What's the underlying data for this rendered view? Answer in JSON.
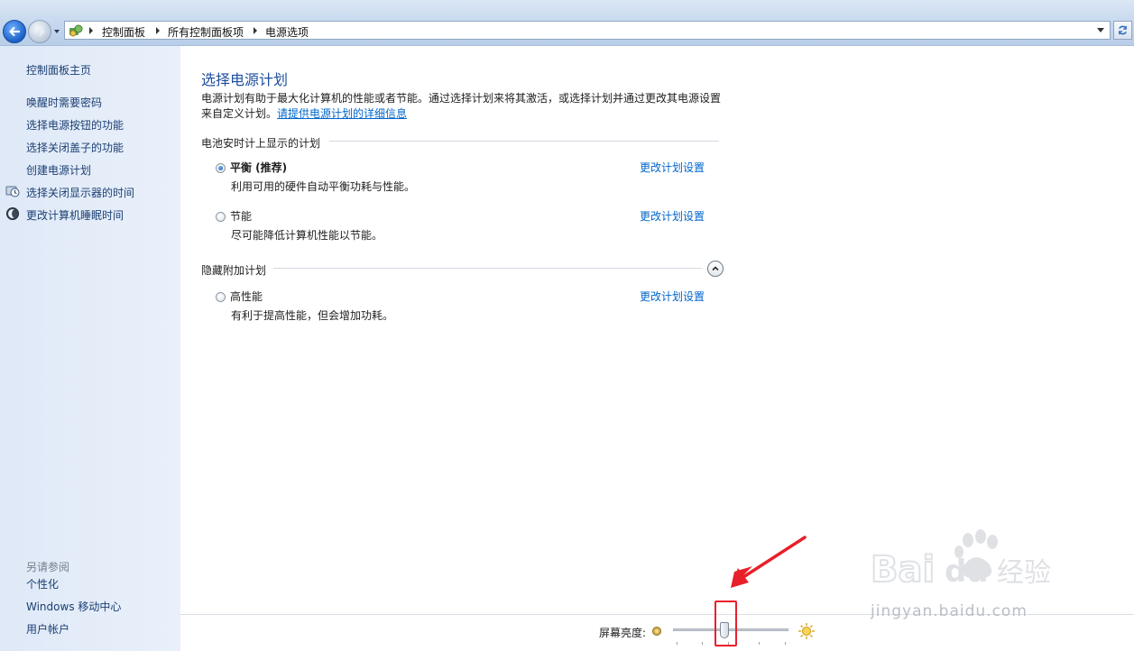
{
  "breadcrumb": {
    "items": [
      "控制面板",
      "所有控制面板项",
      "电源选项"
    ]
  },
  "sidebar": {
    "home_label": "控制面板主页",
    "links": [
      {
        "label": "唤醒时需要密码"
      },
      {
        "label": "选择电源按钮的功能"
      },
      {
        "label": "选择关闭盖子的功能"
      },
      {
        "label": "创建电源计划"
      },
      {
        "label": "选择关闭显示器的时间",
        "icon": "clock-monitor-icon"
      },
      {
        "label": "更改计算机睡眠时间",
        "icon": "moon-icon"
      }
    ],
    "see_also_title": "另请参阅",
    "see_also": [
      {
        "label": "个性化"
      },
      {
        "label": "Windows 移动中心"
      },
      {
        "label": "用户帐户"
      }
    ]
  },
  "main": {
    "title": "选择电源计划",
    "description_line1": "电源计划有助于最大化计算机的性能或者节能。通过选择计划来将其激活，或选择计划并通过更改其电源设置",
    "description_line2": "来自定义计划。",
    "description_link": "请提供电源计划的详细信息",
    "battery_group_title": "电池安时计上显示的计划",
    "hidden_group_title": "隐藏附加计划",
    "plans": [
      {
        "name": "平衡 (推荐)",
        "desc": "利用可用的硬件自动平衡功耗与性能。",
        "link": "更改计划设置",
        "selected": true
      },
      {
        "name": "节能",
        "desc": "尽可能降低计算机性能以节能。",
        "link": "更改计划设置",
        "selected": false
      },
      {
        "name": "高性能",
        "desc": "有利于提高性能，但会增加功耗。",
        "link": "更改计划设置",
        "selected": false
      }
    ]
  },
  "brightness": {
    "label": "屏幕亮度:",
    "level": 0.44
  },
  "watermark": {
    "text": "jingyan.baidu.com",
    "brand": "Baidu经验"
  },
  "colors": {
    "link": "#0066cc",
    "title": "#1e4e9e",
    "annotation": "#e8202a"
  }
}
